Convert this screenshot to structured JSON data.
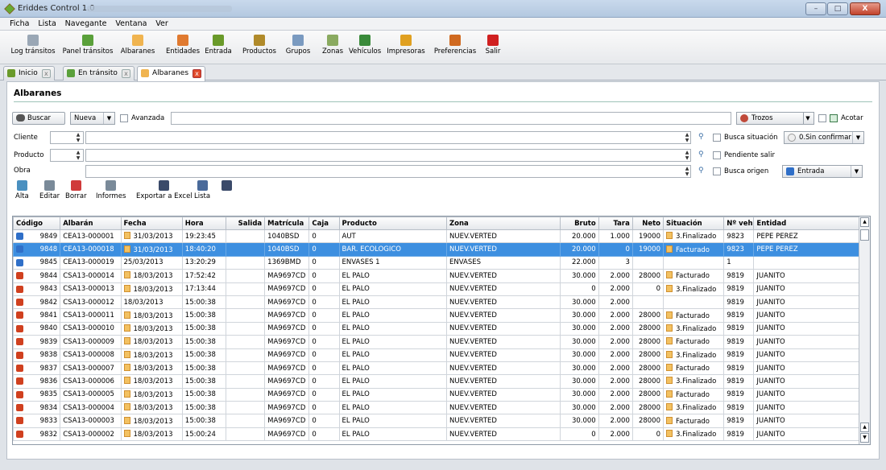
{
  "window": {
    "title": "Eriddes Control 1.0",
    "min": "–",
    "max": "□",
    "close": "X"
  },
  "menu": [
    "Ficha",
    "Lista",
    "Navegante",
    "Ventana",
    "Ver"
  ],
  "toolbar": [
    {
      "label": "Log tránsitos",
      "icon": "log-icon",
      "color": "#9aa7b5"
    },
    {
      "label": "Panel tránsitos",
      "icon": "panel-icon",
      "color": "#5aa03a"
    },
    {
      "label": "Albaranes",
      "icon": "albaranes-icon",
      "color": "#f0b450"
    },
    {
      "label": "Entidades",
      "icon": "entidades-icon",
      "color": "#e07a30"
    },
    {
      "label": "Entrada",
      "icon": "entrada-icon",
      "color": "#6a9a2a"
    },
    {
      "label": "Productos",
      "icon": "productos-icon",
      "color": "#b08a2a"
    },
    {
      "label": "Grupos",
      "icon": "grupos-icon",
      "color": "#7a9ac0"
    },
    {
      "label": "Zonas",
      "icon": "zonas-icon",
      "color": "#8aaa60"
    },
    {
      "label": "Vehículos",
      "icon": "vehiculos-icon",
      "color": "#3a8a3a"
    },
    {
      "label": "Impresoras",
      "icon": "impresoras-icon",
      "color": "#e0a020"
    },
    {
      "label": "Preferencias",
      "icon": "preferencias-icon",
      "color": "#d06a20"
    },
    {
      "label": "Salir",
      "icon": "salir-icon",
      "color": "#d02020"
    }
  ],
  "tabs": [
    {
      "label": "Inicio",
      "icon": "home-icon",
      "color": "#6a9a2a"
    },
    {
      "label": "En tránsito",
      "icon": "transit-icon",
      "color": "#5aa03a"
    },
    {
      "label": "Albaranes",
      "icon": "albaranes-icon",
      "color": "#f0b450"
    }
  ],
  "panel": {
    "title": "Albaranes"
  },
  "search": {
    "buscar": "Buscar",
    "mode": "Nueva",
    "avanzada": "Avanzada",
    "query": "",
    "trozos": "Trozos",
    "acotar": "Acotar",
    "cliente_label": "Cliente",
    "producto_label": "Producto",
    "obra_label": "Obra",
    "busca_situacion": "Busca situación",
    "sin_confirmar": "0.Sin confirmar",
    "pendiente_salir": "Pendiente salir",
    "busca_origen": "Busca origen",
    "entrada": "Entrada"
  },
  "actions": [
    {
      "label": "Alta",
      "icon": "alta-icon",
      "color": "#4a90c0"
    },
    {
      "label": "Editar",
      "icon": "editar-icon",
      "color": "#7a8a99"
    },
    {
      "label": "Borrar",
      "icon": "borrar-icon",
      "color": "#d03a3a"
    },
    {
      "label": "Informes",
      "icon": "printer-icon",
      "color": "#7a8a99"
    },
    {
      "label": "Exportar a Excel",
      "icon": "save-icon",
      "color": "#3a4a6a"
    },
    {
      "label": "Lista",
      "icon": "list-icon",
      "color": "#4a6a9a"
    },
    {
      "label": "",
      "icon": "print-list-icon",
      "color": "#3a4a6a"
    }
  ],
  "table": {
    "columns": [
      "Código",
      "Albarán",
      "Fecha",
      "Hora",
      "Salida",
      "Matrícula",
      "Caja",
      "Producto",
      "Zona",
      "Bruto",
      "Tara",
      "Neto",
      "Situación",
      "Nº veh",
      "Entidad"
    ],
    "rows": [
      {
        "dir": "in",
        "codigo": "9849",
        "albaran": "CEA13-000001",
        "fdoc": true,
        "fecha": "31/03/2013",
        "hora": "19:23:45",
        "salida": "",
        "matricula": "1040BSD",
        "caja": "0",
        "producto": "AUT",
        "zona": "NUEV.VERTED",
        "bruto": "20.000",
        "tara": "1.000",
        "neto": "19000",
        "sdoc": true,
        "situacion": "3.Finalizado",
        "nveh": "9823",
        "entidad": "PEPE PEREZ"
      },
      {
        "dir": "in",
        "sel": true,
        "codigo": "9848",
        "albaran": "CEA13-000018",
        "fdoc": true,
        "fecha": "31/03/2013",
        "hora": "18:40:20",
        "salida": "",
        "matricula": "1040BSD",
        "caja": "0",
        "producto": "BAR. ECOLOGICO",
        "zona": "NUEV.VERTED",
        "bruto": "20.000",
        "tara": "0",
        "neto": "19000",
        "sdoc": true,
        "situacion": "Facturado",
        "nveh": "9823",
        "entidad": "PEPE PEREZ"
      },
      {
        "dir": "in",
        "codigo": "9845",
        "albaran": "CEA13-000019",
        "fdoc": false,
        "fecha": "25/03/2013",
        "hora": "13:20:29",
        "salida": "",
        "matricula": "1369BMD",
        "caja": "0",
        "producto": "ENVASES 1",
        "zona": "ENVASES",
        "bruto": "22.000",
        "tara": "3",
        "neto": "",
        "sdoc": false,
        "situacion": "",
        "nveh": "1",
        "entidad": ""
      },
      {
        "dir": "out",
        "codigo": "9844",
        "albaran": "CSA13-000014",
        "fdoc": true,
        "fecha": "18/03/2013",
        "hora": "17:52:42",
        "salida": "",
        "matricula": "MA9697CD",
        "caja": "0",
        "producto": "EL PALO",
        "zona": "NUEV.VERTED",
        "bruto": "30.000",
        "tara": "2.000",
        "neto": "28000",
        "sdoc": true,
        "situacion": "Facturado",
        "nveh": "9819",
        "entidad": "JUANITO"
      },
      {
        "dir": "out",
        "codigo": "9843",
        "albaran": "CSA13-000013",
        "fdoc": true,
        "fecha": "18/03/2013",
        "hora": "17:13:44",
        "salida": "",
        "matricula": "MA9697CD",
        "caja": "0",
        "producto": "EL PALO",
        "zona": "NUEV.VERTED",
        "bruto": "0",
        "tara": "2.000",
        "neto": "0",
        "sdoc": true,
        "situacion": "3.Finalizado",
        "nveh": "9819",
        "entidad": "JUANITO"
      },
      {
        "dir": "out",
        "codigo": "9842",
        "albaran": "CSA13-000012",
        "fdoc": false,
        "fecha": "18/03/2013",
        "hora": "15:00:38",
        "salida": "",
        "matricula": "MA9697CD",
        "caja": "0",
        "producto": "EL PALO",
        "zona": "NUEV.VERTED",
        "bruto": "30.000",
        "tara": "2.000",
        "neto": "",
        "sdoc": false,
        "situacion": "",
        "nveh": "9819",
        "entidad": "JUANITO"
      },
      {
        "dir": "out",
        "codigo": "9841",
        "albaran": "CSA13-000011",
        "fdoc": true,
        "fecha": "18/03/2013",
        "hora": "15:00:38",
        "salida": "",
        "matricula": "MA9697CD",
        "caja": "0",
        "producto": "EL PALO",
        "zona": "NUEV.VERTED",
        "bruto": "30.000",
        "tara": "2.000",
        "neto": "28000",
        "sdoc": true,
        "situacion": "Facturado",
        "nveh": "9819",
        "entidad": "JUANITO"
      },
      {
        "dir": "out",
        "codigo": "9840",
        "albaran": "CSA13-000010",
        "fdoc": true,
        "fecha": "18/03/2013",
        "hora": "15:00:38",
        "salida": "",
        "matricula": "MA9697CD",
        "caja": "0",
        "producto": "EL PALO",
        "zona": "NUEV.VERTED",
        "bruto": "30.000",
        "tara": "2.000",
        "neto": "28000",
        "sdoc": true,
        "situacion": "3.Finalizado",
        "nveh": "9819",
        "entidad": "JUANITO"
      },
      {
        "dir": "out",
        "codigo": "9839",
        "albaran": "CSA13-000009",
        "fdoc": true,
        "fecha": "18/03/2013",
        "hora": "15:00:38",
        "salida": "",
        "matricula": "MA9697CD",
        "caja": "0",
        "producto": "EL PALO",
        "zona": "NUEV.VERTED",
        "bruto": "30.000",
        "tara": "2.000",
        "neto": "28000",
        "sdoc": true,
        "situacion": "Facturado",
        "nveh": "9819",
        "entidad": "JUANITO"
      },
      {
        "dir": "out",
        "codigo": "9838",
        "albaran": "CSA13-000008",
        "fdoc": true,
        "fecha": "18/03/2013",
        "hora": "15:00:38",
        "salida": "",
        "matricula": "MA9697CD",
        "caja": "0",
        "producto": "EL PALO",
        "zona": "NUEV.VERTED",
        "bruto": "30.000",
        "tara": "2.000",
        "neto": "28000",
        "sdoc": true,
        "situacion": "3.Finalizado",
        "nveh": "9819",
        "entidad": "JUANITO"
      },
      {
        "dir": "out",
        "codigo": "9837",
        "albaran": "CSA13-000007",
        "fdoc": true,
        "fecha": "18/03/2013",
        "hora": "15:00:38",
        "salida": "",
        "matricula": "MA9697CD",
        "caja": "0",
        "producto": "EL PALO",
        "zona": "NUEV.VERTED",
        "bruto": "30.000",
        "tara": "2.000",
        "neto": "28000",
        "sdoc": true,
        "situacion": "Facturado",
        "nveh": "9819",
        "entidad": "JUANITO"
      },
      {
        "dir": "out",
        "codigo": "9836",
        "albaran": "CSA13-000006",
        "fdoc": true,
        "fecha": "18/03/2013",
        "hora": "15:00:38",
        "salida": "",
        "matricula": "MA9697CD",
        "caja": "0",
        "producto": "EL PALO",
        "zona": "NUEV.VERTED",
        "bruto": "30.000",
        "tara": "2.000",
        "neto": "28000",
        "sdoc": true,
        "situacion": "3.Finalizado",
        "nveh": "9819",
        "entidad": "JUANITO"
      },
      {
        "dir": "out",
        "codigo": "9835",
        "albaran": "CSA13-000005",
        "fdoc": true,
        "fecha": "18/03/2013",
        "hora": "15:00:38",
        "salida": "",
        "matricula": "MA9697CD",
        "caja": "0",
        "producto": "EL PALO",
        "zona": "NUEV.VERTED",
        "bruto": "30.000",
        "tara": "2.000",
        "neto": "28000",
        "sdoc": true,
        "situacion": "Facturado",
        "nveh": "9819",
        "entidad": "JUANITO"
      },
      {
        "dir": "out",
        "codigo": "9834",
        "albaran": "CSA13-000004",
        "fdoc": true,
        "fecha": "18/03/2013",
        "hora": "15:00:38",
        "salida": "",
        "matricula": "MA9697CD",
        "caja": "0",
        "producto": "EL PALO",
        "zona": "NUEV.VERTED",
        "bruto": "30.000",
        "tara": "2.000",
        "neto": "28000",
        "sdoc": true,
        "situacion": "3.Finalizado",
        "nveh": "9819",
        "entidad": "JUANITO"
      },
      {
        "dir": "out",
        "codigo": "9833",
        "albaran": "CSA13-000003",
        "fdoc": true,
        "fecha": "18/03/2013",
        "hora": "15:00:38",
        "salida": "",
        "matricula": "MA9697CD",
        "caja": "0",
        "producto": "EL PALO",
        "zona": "NUEV.VERTED",
        "bruto": "30.000",
        "tara": "2.000",
        "neto": "28000",
        "sdoc": true,
        "situacion": "Facturado",
        "nveh": "9819",
        "entidad": "JUANITO"
      },
      {
        "dir": "out",
        "codigo": "9832",
        "albaran": "CSA13-000002",
        "fdoc": true,
        "fecha": "18/03/2013",
        "hora": "15:00:24",
        "salida": "",
        "matricula": "MA9697CD",
        "caja": "0",
        "producto": "EL PALO",
        "zona": "NUEV.VERTED",
        "bruto": "0",
        "tara": "2.000",
        "neto": "0",
        "sdoc": true,
        "situacion": "3.Finalizado",
        "nveh": "9819",
        "entidad": "JUANITO"
      }
    ]
  }
}
